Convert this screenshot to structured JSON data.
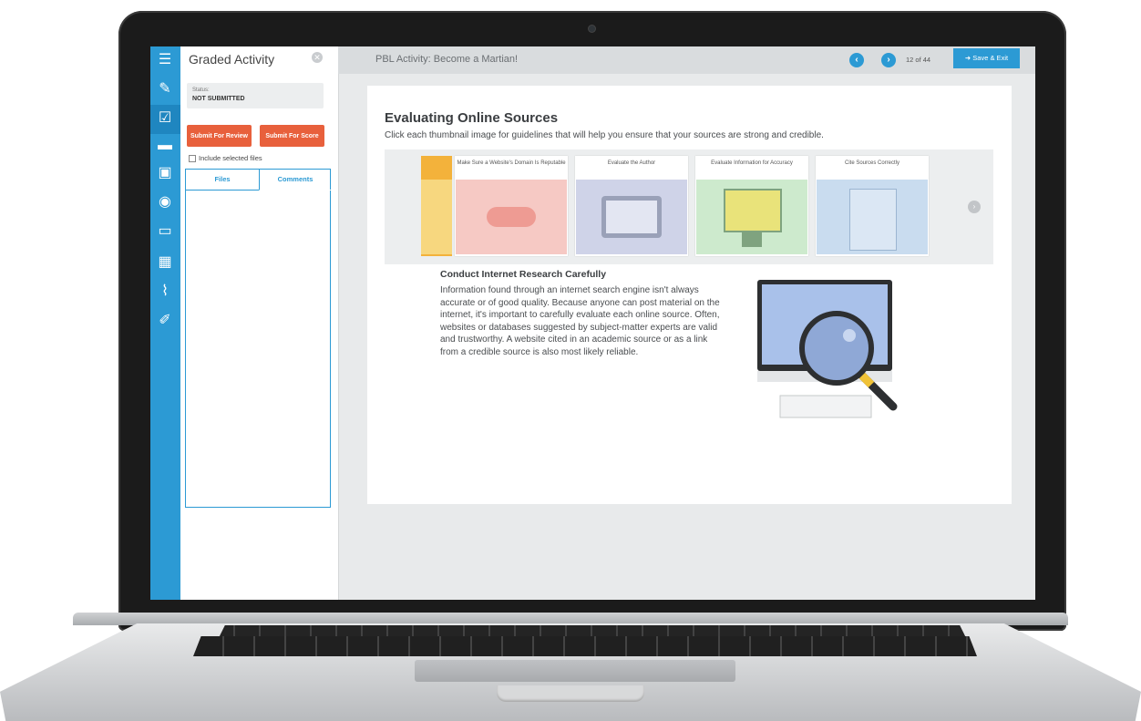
{
  "panel": {
    "title": "Graded Activity",
    "status_label": "Status:",
    "status_value": "NOT SUBMITTED",
    "submit_review": "Submit For Review",
    "submit_score": "Submit For Score",
    "include_files": "Include selected files",
    "tab_files": "Files",
    "tab_comments": "Comments"
  },
  "rail": {
    "icons": [
      "list-icon",
      "edit-icon",
      "graded-activity-icon",
      "folder-icon",
      "glossary-icon",
      "audio-icon",
      "help-icon",
      "calculator-icon",
      "chart-icon",
      "highlighter-icon"
    ]
  },
  "header": {
    "title": "PBL Activity: Become a Martian!",
    "page_count": "12  of  44",
    "save_exit": "Save & Exit"
  },
  "content": {
    "title": "Evaluating Online Sources",
    "subtitle": "Click each thumbnail image for guidelines that will help you ensure that your sources are strong and credible.",
    "thumbnails": [
      {
        "label": "Make Sure a Website's Domain Is Reputable",
        "color": "#f6c9c4"
      },
      {
        "label": "Evaluate the Author",
        "color": "#cfd3e8"
      },
      {
        "label": "Evaluate Information for Accuracy",
        "color": "#cdeacd"
      },
      {
        "label": "Cite Sources Correctly",
        "color": "#c9dcef"
      }
    ],
    "article_title": "Conduct Internet Research Carefully",
    "article_body": "Information found through an internet search engine isn't always accurate or of good quality. Because anyone can post material on the internet, it's important to carefully evaluate each online source. Often, websites or databases suggested by subject-matter experts are valid and trustworthy. A website cited in an academic source or as a link from a credible source is also most likely reliable."
  },
  "colors": {
    "accent": "#2c9ad4",
    "submit": "#e8603c"
  }
}
